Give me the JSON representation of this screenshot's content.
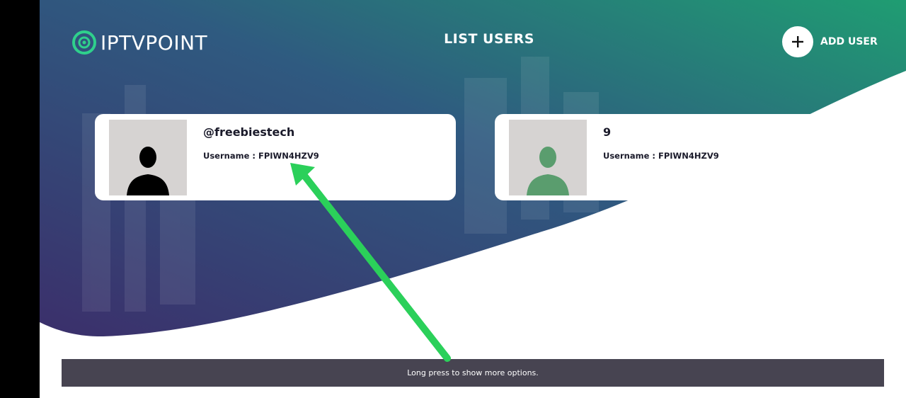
{
  "app": {
    "logo_text": "IPTVPOINT"
  },
  "header": {
    "title": "LIST USERS",
    "add_user_label": "ADD USER"
  },
  "users": [
    {
      "name": "@freebiestech",
      "username_label": "Username : FPIWN4HZV9",
      "avatar_color": "#000000"
    },
    {
      "name": "9",
      "username_label": "Username : FPIWN4HZV9",
      "avatar_color": "#5a9d6e"
    }
  ],
  "toast": {
    "message": "Long press to show more options."
  },
  "colors": {
    "bg_gradient_start": "#3b2f6b",
    "bg_gradient_end": "#1f9d72",
    "annotation_arrow": "#2bd05a",
    "toast_bg": "#474451"
  }
}
